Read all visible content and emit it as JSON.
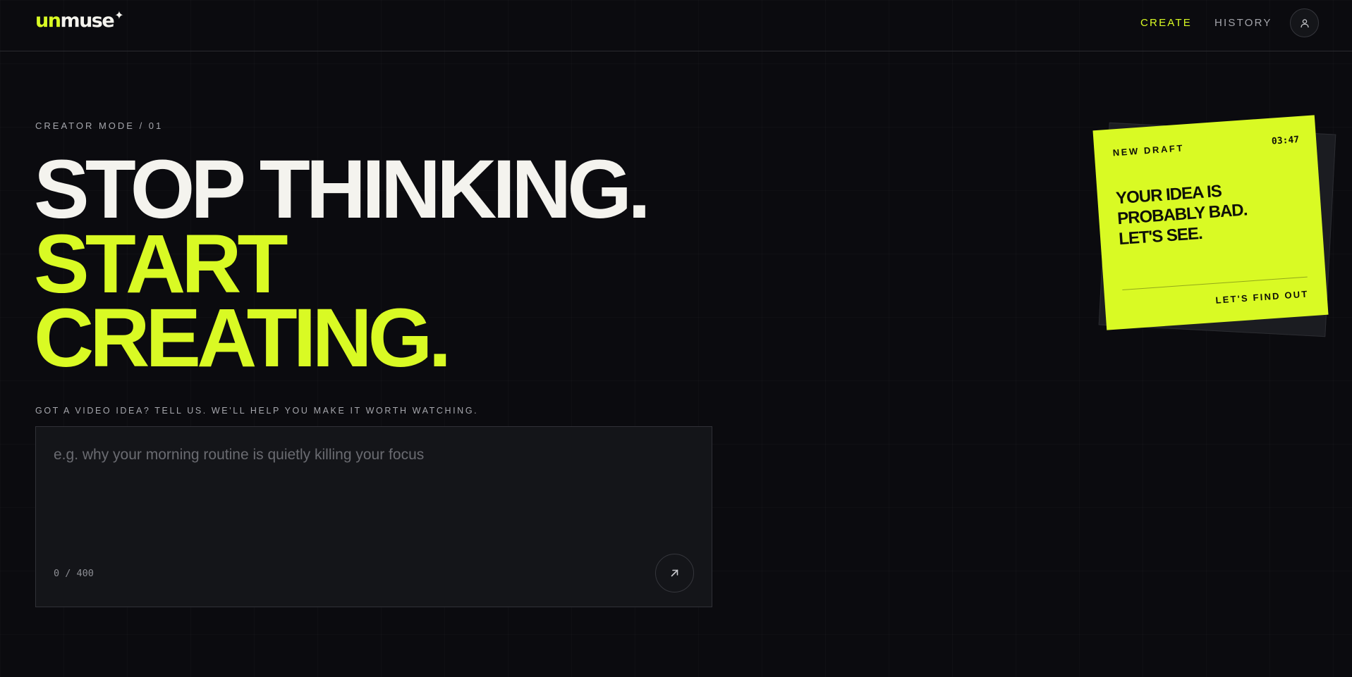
{
  "header": {
    "logo_part1": "un",
    "logo_part2": "muse",
    "logo_spark": "✦",
    "nav": [
      {
        "label": "CREATE",
        "active": true
      },
      {
        "label": "HISTORY",
        "active": false
      }
    ],
    "profile_icon": "user-icon"
  },
  "hero": {
    "eyebrow": "CREATOR MODE / 01",
    "headline_line1": "STOP THINKING.",
    "headline_line2": "START",
    "headline_line3": "CREATING."
  },
  "composer": {
    "label": "GOT A VIDEO IDEA? TELL US. WE'LL HELP YOU MAKE IT WORTH WATCHING.",
    "value": "",
    "placeholder": "e.g. why your morning routine is quietly killing your focus",
    "counter": "0 / 400",
    "submit_icon": "arrow-up-right-icon"
  },
  "note": {
    "title": "NEW DRAFT",
    "time": "03:47",
    "body_line1": "YOUR IDEA IS",
    "body_line2": "PROBABLY BAD.",
    "body_line3": "LET'S SEE.",
    "cta": "LET'S FIND OUT"
  },
  "colors": {
    "background": "#0b0b0f",
    "accent": "#d9fa24",
    "text": "#f4f3ee",
    "muted": "#a6a7ad",
    "panel": "#141519"
  }
}
